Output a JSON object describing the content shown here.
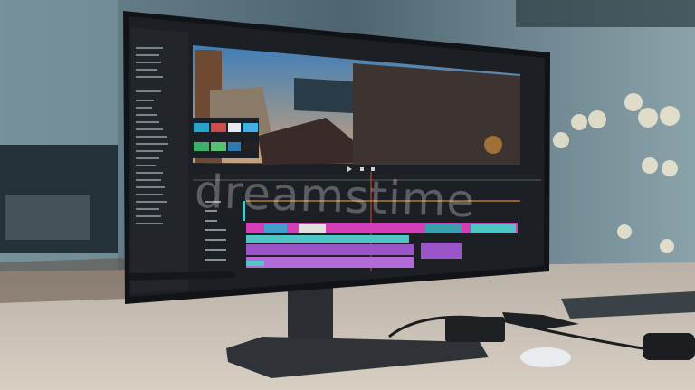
{
  "watermark": {
    "text": "dreamstime"
  },
  "colors": {
    "screen_bg": "#1c1f24",
    "clip_pink": "#d23fb6",
    "clip_teal": "#4fc6c6",
    "clip_purple": "#9a55c8",
    "playhead": "#e0452c",
    "desk": "#c9c0b4"
  }
}
